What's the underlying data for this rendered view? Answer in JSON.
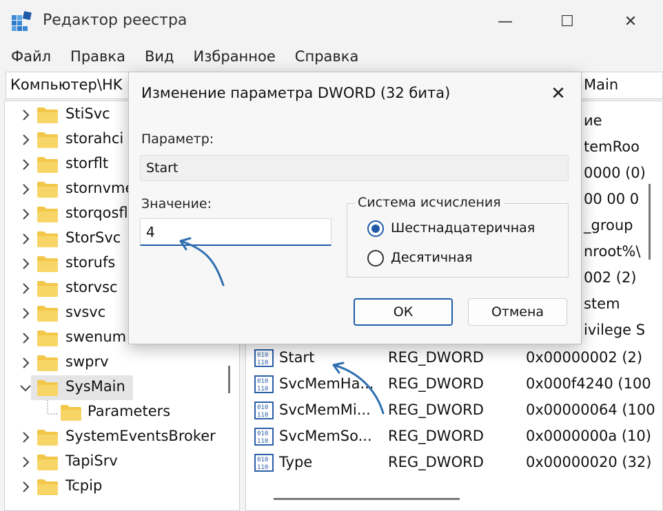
{
  "window": {
    "title": "Редактор реестра",
    "controls": {
      "minimize": "—",
      "maximize": "☐",
      "close": "✕"
    }
  },
  "menu": [
    "Файл",
    "Правка",
    "Вид",
    "Избранное",
    "Справка"
  ],
  "address": {
    "left": "Компьютер\\HK",
    "right": "Main"
  },
  "tree": {
    "items": [
      {
        "label": "StiSvc",
        "expanded": false
      },
      {
        "label": "storahci",
        "expanded": false
      },
      {
        "label": "storflt",
        "expanded": false
      },
      {
        "label": "stornvme",
        "expanded": false
      },
      {
        "label": "storqosflt",
        "expanded": false
      },
      {
        "label": "StorSvc",
        "expanded": false
      },
      {
        "label": "storufs",
        "expanded": false
      },
      {
        "label": "storvsc",
        "expanded": false
      },
      {
        "label": "svsvc",
        "expanded": false
      },
      {
        "label": "swenum",
        "expanded": false
      },
      {
        "label": "swprv",
        "expanded": false
      },
      {
        "label": "SysMain",
        "expanded": true,
        "selected": true
      },
      {
        "label": "Parameters",
        "child": true
      },
      {
        "label": "SystemEventsBroker",
        "expanded": false
      },
      {
        "label": "TapiSrv",
        "expanded": false
      },
      {
        "label": "Tcpip",
        "expanded": false
      }
    ]
  },
  "values_list": {
    "partial_rows": [
      "ие",
      "temRoo",
      "0000 (0)",
      "00 00 0",
      "_group",
      "nroot%\\",
      "002 (2)",
      "stem",
      "ivilege S"
    ],
    "rows": [
      {
        "name": "Start",
        "type": "REG_DWORD",
        "data": "0x00000002 (2)"
      },
      {
        "name": "SvcMemHa...",
        "type": "REG_DWORD",
        "data": "0x000f4240 (100"
      },
      {
        "name": "SvcMemMi...",
        "type": "REG_DWORD",
        "data": "0x00000064 (100"
      },
      {
        "name": "SvcMemSo...",
        "type": "REG_DWORD",
        "data": "0x0000000a (10)"
      },
      {
        "name": "Type",
        "type": "REG_DWORD",
        "data": "0x00000020 (32)"
      }
    ]
  },
  "dialog": {
    "title": "Изменение параметра DWORD (32 бита)",
    "param_label": "Параметр:",
    "param_value": "Start",
    "value_label": "Значение:",
    "value": "4",
    "base_group": "Система исчисления",
    "base_options": [
      {
        "label": "Шестнадцатеричная",
        "selected": true
      },
      {
        "label": "Десятичная",
        "selected": false
      }
    ],
    "ok_label": "ОК",
    "cancel_label": "Отмена"
  },
  "colors": {
    "accent": "#1e5aa8",
    "folder": "#f2c74a",
    "arrow": "#2f6fb0"
  }
}
